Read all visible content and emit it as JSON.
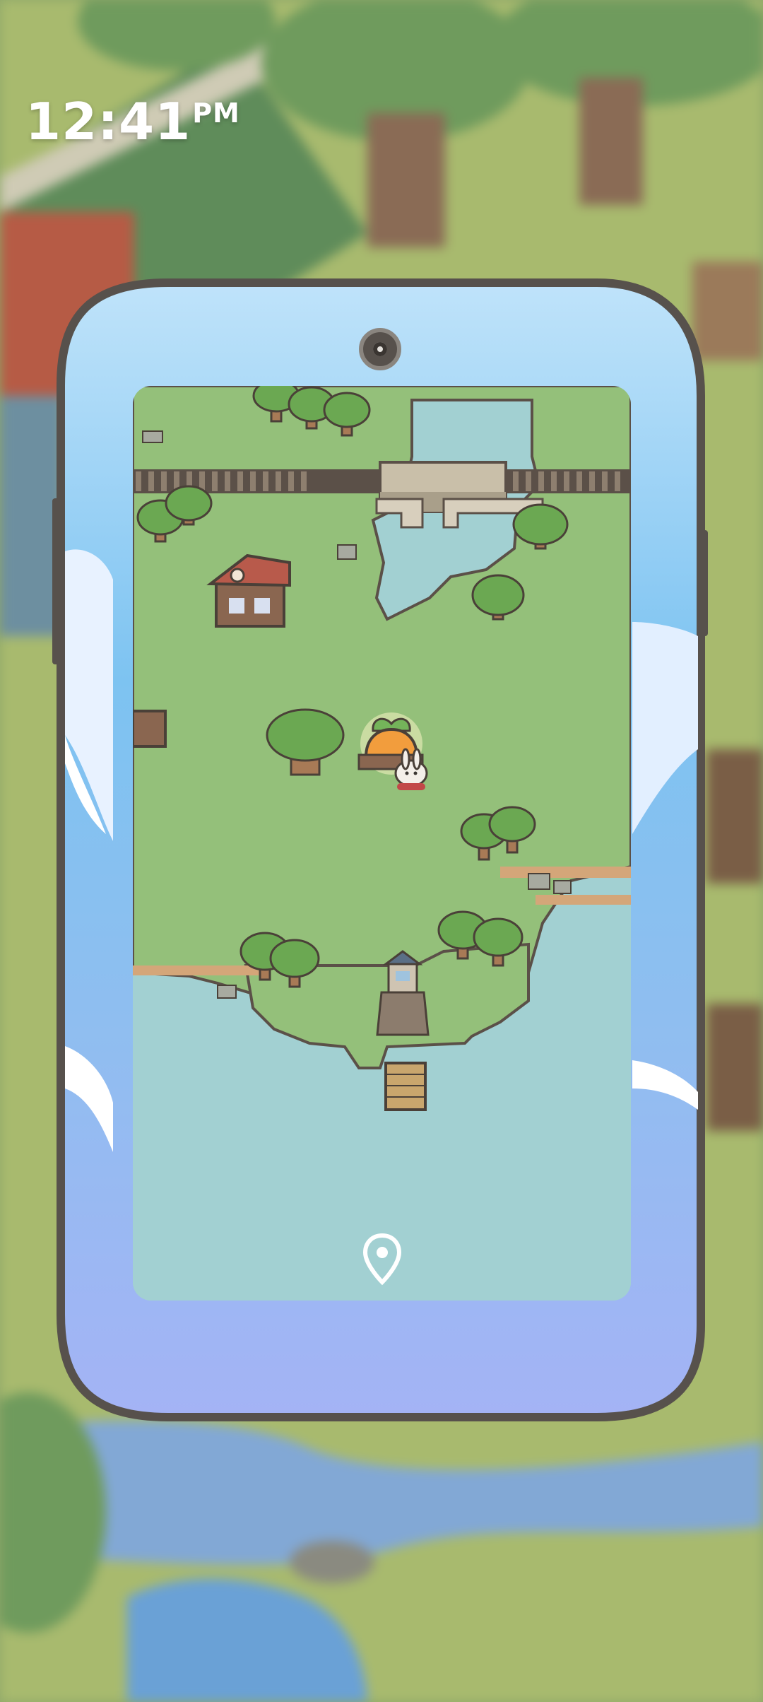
{
  "status_bar": {
    "time": "12:41",
    "ampm": "PM"
  },
  "phone": {
    "camera_icon": "camera-icon"
  },
  "map": {
    "location_icon": "location-pin-icon",
    "colors": {
      "grass": "#94c07a",
      "water": "#a2d0d2",
      "sky": "#9ecff5",
      "frame": "#57514c"
    }
  }
}
